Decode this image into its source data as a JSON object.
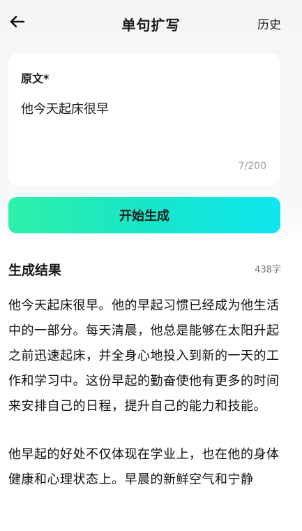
{
  "header": {
    "title": "单句扩写",
    "history_label": "历史"
  },
  "input_card": {
    "label": "原文*",
    "value": "他今天起床很早",
    "counter": "7/200"
  },
  "generate_button": {
    "label": "开始生成"
  },
  "result": {
    "title": "生成结果",
    "word_count": "438字",
    "paragraphs": [
      "他今天起床很早。他的早起习惯已经成为他生活中的一部分。每天清晨，他总是能够在太阳升起之前迅速起床，并全身心地投入到新的一天的工作和学习中。这份早起的勤奋使他有更多的时间来安排自己的日程，提升自己的能力和技能。",
      "他早起的好处不仅体现在学业上，也在他的身体健康和心理状态上。早晨的新鲜空气和宁静"
    ]
  },
  "colors": {
    "button_gradient_start": "#2ef0a8",
    "button_gradient_end": "#10e6f0",
    "counter_text": "#9a9a9a"
  }
}
